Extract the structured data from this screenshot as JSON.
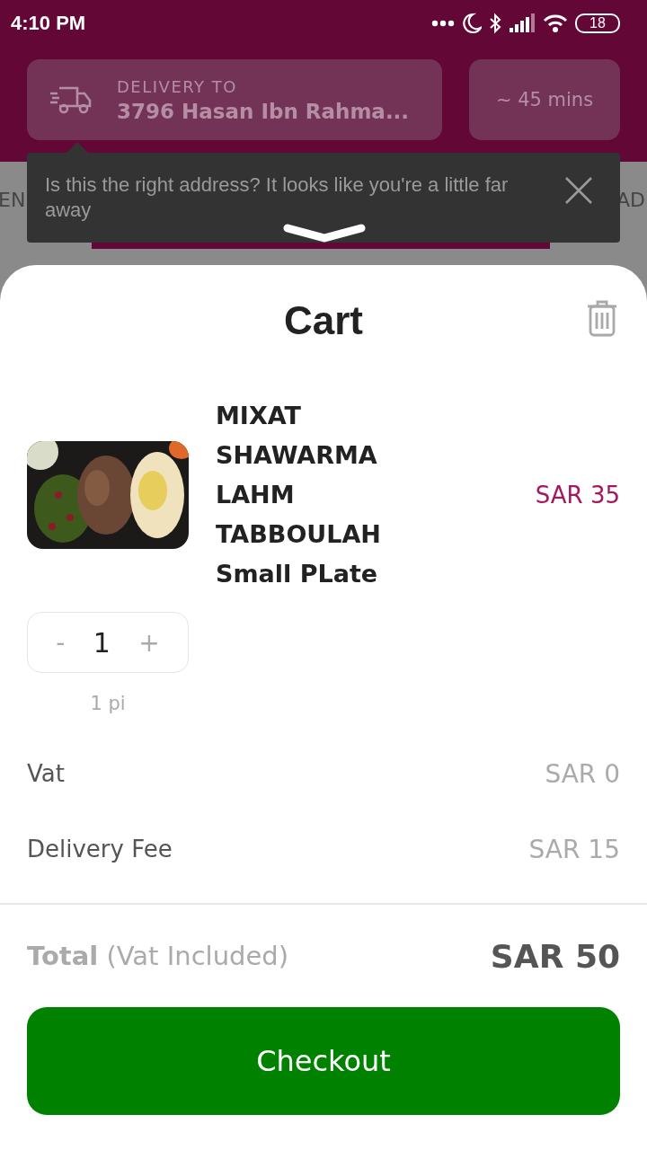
{
  "status_bar": {
    "time": "4:10 PM",
    "battery": "18"
  },
  "header": {
    "delivery_label": "DELIVERY TO",
    "address": "3796 Hasan Ibn Rahma...",
    "eta": "~ 45 mins"
  },
  "background_tabs": [
    "EN",
    "AD"
  ],
  "tooltip": {
    "message": "Is this the right address? It looks like you're a little far away"
  },
  "cart": {
    "title": "Cart",
    "items": [
      {
        "kind": "picture",
        "name": "MIXAT SHAWARMA LAHM TABBOULAH Small PLate",
        "price": "SAR 35",
        "minus": "-",
        "quantity": "1",
        "plus": "+",
        "unit": "1 pi"
      }
    ],
    "summary": [
      {
        "label": "Vat",
        "value": "SAR 0"
      },
      {
        "label": "Delivery Fee",
        "value": "SAR 15"
      }
    ],
    "total": {
      "label": "Total",
      "note": "(Vat Included)",
      "value": "SAR 50"
    },
    "checkout": "Checkout"
  }
}
